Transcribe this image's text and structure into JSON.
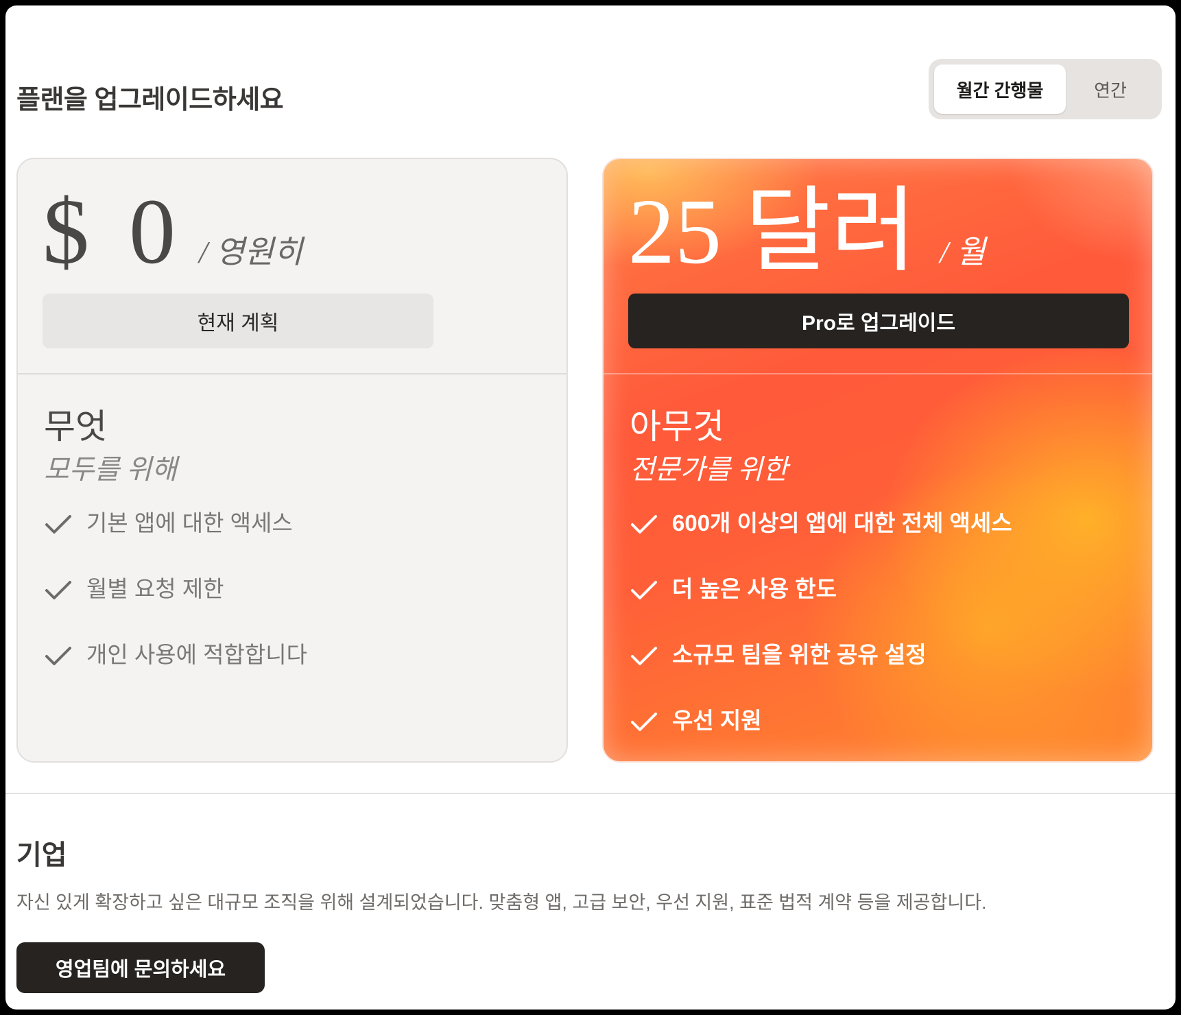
{
  "header": {
    "title": "플랜을 업그레이드하세요",
    "billing_toggle": {
      "monthly_label": "월간 간행물",
      "annual_label": "연간",
      "selected": "monthly"
    }
  },
  "plans": {
    "free": {
      "price": "$ 0",
      "price_unit": "/ 영원히",
      "button_label": "현재 계획",
      "name": "무엇",
      "subtitle": "모두를 위해",
      "features": [
        "기본 앱에 대한 액세스",
        "월별 요청 제한",
        "개인 사용에 적합합니다"
      ]
    },
    "pro": {
      "price": "25 달러",
      "price_unit": "/ 월",
      "button_label": "Pro로 업그레이드",
      "name": "아무것",
      "subtitle": "전문가를 위한",
      "features": [
        "600개 이상의 앱에 대한 전체 액세스",
        "더 높은 사용 한도",
        "소규모 팀을 위한 공유 설정",
        "우선 지원"
      ],
      "accent_colors": [
        "#ff5a3a",
        "#ffb428"
      ]
    }
  },
  "enterprise": {
    "title": "기업",
    "description": "자신 있게 확장하고 싶은 대규모 조직을 위해 설계되었습니다. 맞춤형 앱, 고급 보안, 우선 지원, 표준 법적 계약 등을 제공합니다.",
    "button_label": "영업팀에 문의하세요"
  },
  "icons": {
    "feature_check": "check-icon"
  }
}
